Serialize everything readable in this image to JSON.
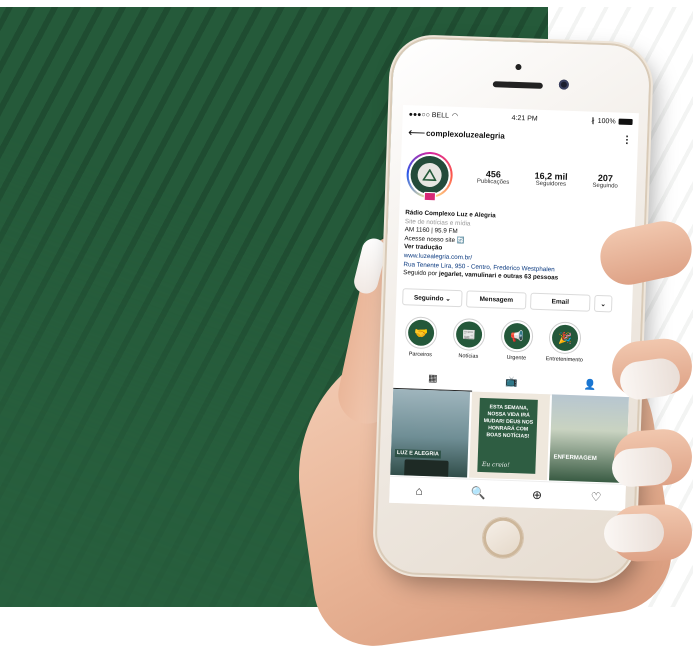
{
  "status_bar": {
    "carrier": "●●●○○ BELL",
    "wifi_icon": "wifi-icon",
    "time": "4:21 PM",
    "bluetooth_icon": "bluetooth-icon",
    "battery": "100%",
    "battery_icon": "battery-icon"
  },
  "profile": {
    "username": "complexoluzealegria",
    "posts_count": "456",
    "posts_label": "Publicações",
    "followers_count": "16,2 mil",
    "followers_label": "Seguidores",
    "following_count": "207",
    "following_label": "Seguindo"
  },
  "bio": {
    "name": "Rádio Complexo Luz e Alegria",
    "category": "Site de notícias e mídia",
    "frequency": "AM 1160 | 95.9 FM",
    "site_prompt": "Acesse nosso site 🔄",
    "translate": "Ver tradução",
    "website": "www.luzealegria.com.br/",
    "address": "Rua Tenente Lira, 950 - Centro, Frederico Westphalen",
    "followed_prefix": "Seguido por ",
    "followed_names": "jegarlet, vamulinari e outras 63 pessoas"
  },
  "actions": {
    "following": "Seguindo ⌄",
    "message": "Mensagem",
    "email": "Email",
    "more": "⌄"
  },
  "highlights": [
    {
      "label": "Parceiros",
      "icon": "handshake-icon",
      "glyph": "🤝"
    },
    {
      "label": "Notícias",
      "icon": "newspaper-icon",
      "glyph": "📰"
    },
    {
      "label": "Urgente",
      "icon": "megaphone-icon",
      "glyph": "📢"
    },
    {
      "label": "Entretenimento",
      "icon": "confetti-icon",
      "glyph": "🎉"
    }
  ],
  "tabs": {
    "grid": "▦",
    "igtv": "📺",
    "tagged": "👤"
  },
  "posts": {
    "post1_badge": "LUZ E ALEGRIA",
    "post2_text": "ESTA SEMANA, NOSSA VIDA IRÁ MUDAR! DEUS NOS HONRARÁ COM BOAS NOTÍCIAS!",
    "post2_sign": "Eu creio!",
    "post3_title": "ENFERMAGEM"
  },
  "bottom_nav": {
    "home": "⌂",
    "search": "🔍",
    "add": "⊕",
    "heart": "♡"
  },
  "colors": {
    "brand_green": "#255a3a",
    "link_blue": "#0c3b80"
  }
}
